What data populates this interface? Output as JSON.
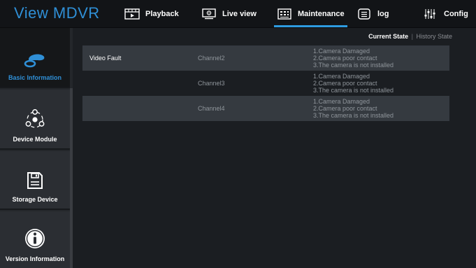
{
  "app": {
    "brand": "View MDVR"
  },
  "nav": [
    {
      "label": "Playback",
      "icon": "playback-icon",
      "active": false
    },
    {
      "label": "Live view",
      "icon": "live-view-icon",
      "active": false
    },
    {
      "label": "Maintenance",
      "icon": "maintenance-icon",
      "active": true
    },
    {
      "label": "log",
      "icon": "log-icon",
      "active": false
    },
    {
      "label": "Config",
      "icon": "config-icon",
      "active": false
    }
  ],
  "sidebar": [
    {
      "label": "Basic Information",
      "icon": "basic-info-icon",
      "active": true
    },
    {
      "label": "Device Module",
      "icon": "device-module-icon",
      "active": false
    },
    {
      "label": "Storage Device",
      "icon": "storage-device-icon",
      "active": false
    },
    {
      "label": "Version Information",
      "icon": "info-icon",
      "active": false
    }
  ],
  "state_tabs": {
    "current": "Current State",
    "separator": "|",
    "history": "History State"
  },
  "faults": [
    {
      "type": "Video Fault",
      "channel": "Channel2",
      "details": [
        "1.Camera Damaged",
        "2.Camera poor contact",
        "3.The camera is not installed"
      ]
    },
    {
      "type": "",
      "channel": "Channel3",
      "details": [
        "1.Camera Damaged",
        "2.Camera poor contact",
        "3.The camera is not installed"
      ]
    },
    {
      "type": "",
      "channel": "Channel4",
      "details": [
        "1.Camera Damaged",
        "2.Camera poor contact",
        "3.The camera is not installed"
      ]
    }
  ],
  "colors": {
    "accent": "#2f8fd6",
    "active_underline": "#2e9be0",
    "row_highlight": "#353a40"
  }
}
